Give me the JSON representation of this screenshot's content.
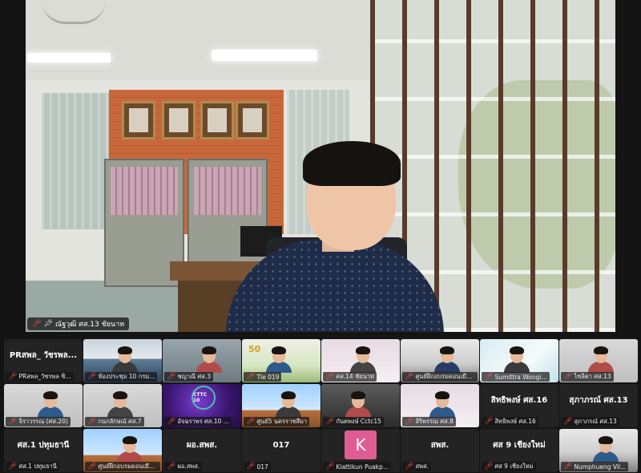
{
  "main_speaker": {
    "label": "ณัฐวุฒิ ศส.13 ชัยนาท"
  },
  "icons": {
    "mic_off": "mic-off-icon",
    "pin": "pin-icon"
  },
  "colors": {
    "background": "#141414",
    "mic_off": "#ff4d4f",
    "tile_bg": "#232323",
    "avatar_k": "#e05d93"
  },
  "gallery": [
    {
      "id": "t1",
      "kind": "name",
      "name": "PRสพล_ วัชรพล...",
      "label": "PRสพล_วัชรพล ชิ..."
    },
    {
      "id": "t2",
      "kind": "video",
      "style": "v-blue",
      "label": "ห้องประชุม 10 กรม..."
    },
    {
      "id": "t3",
      "kind": "video",
      "style": "v-office",
      "label": "ชญาณี ศส.3"
    },
    {
      "id": "t4",
      "kind": "video",
      "style": "v-green",
      "label": "Tle 019"
    },
    {
      "id": "t5",
      "kind": "video",
      "style": "v-pink",
      "label": "ศส.14 ชัยนาท"
    },
    {
      "id": "t6",
      "kind": "video",
      "style": "v-room",
      "label": "ศูนย์ฝึกอบรมดอนเมือง..."
    },
    {
      "id": "t7",
      "kind": "video",
      "style": "v-cyan",
      "label": "Sumittra Wongi..."
    },
    {
      "id": "t8",
      "kind": "video",
      "style": "v-gray",
      "label": "ไซลิตา ศส.13"
    },
    {
      "id": "t9",
      "kind": "video",
      "style": "v-gray",
      "label": "จิราวรรณ (ศส.20)"
    },
    {
      "id": "t10",
      "kind": "video",
      "style": "v-gray",
      "label": "กนกลักษณ์ ศส.7"
    },
    {
      "id": "t11",
      "kind": "video",
      "style": "v-purple",
      "label": "อัจฉราพร ศส.10 ..."
    },
    {
      "id": "t12",
      "kind": "video",
      "style": "v-sky",
      "label": "ศูนย์5 นครราชสีมา"
    },
    {
      "id": "t13",
      "kind": "video",
      "style": "v-dark",
      "label": "กันตพงษ์ Cctc15"
    },
    {
      "id": "t14",
      "kind": "video",
      "style": "v-pink",
      "label": "สิริพรรณ ศส.8"
    },
    {
      "id": "t15",
      "kind": "name",
      "name": "สิทธิพงษ์ ศส.16",
      "label": "สิทธิพงษ์ ศส.16"
    },
    {
      "id": "t16",
      "kind": "name",
      "name": "สุภาภรณ์ ศส.13",
      "label": "สุภาภรณ์ ศส.13"
    },
    {
      "id": "t17",
      "kind": "name",
      "name": "ศส.1 ปทุมธานี",
      "label": "ศส.1 ปทุมธานี"
    },
    {
      "id": "t18",
      "kind": "video",
      "style": "v-sky",
      "label": "ศูนย์ฝึกอบรมดอนเมือง..."
    },
    {
      "id": "t19",
      "kind": "name",
      "name": "ผอ.สพส.",
      "label": "ผอ.สพส."
    },
    {
      "id": "t20",
      "kind": "name",
      "name": "017",
      "label": "017"
    },
    {
      "id": "t21",
      "kind": "avatar",
      "initial": "K",
      "label": "Kiattikun Puakp..."
    },
    {
      "id": "t22",
      "kind": "name",
      "name": "สพส.",
      "label": "สพส."
    },
    {
      "id": "t23",
      "kind": "name",
      "name": "ศส 9 เชียงใหม่",
      "label": "ศส 9 เชียงใหม่"
    },
    {
      "id": "t24",
      "kind": "video",
      "style": "v-room",
      "label": "Numphueng Vil..."
    }
  ],
  "overlay_text": {
    "cttc": "CTTC 10",
    "fifty": "50"
  }
}
